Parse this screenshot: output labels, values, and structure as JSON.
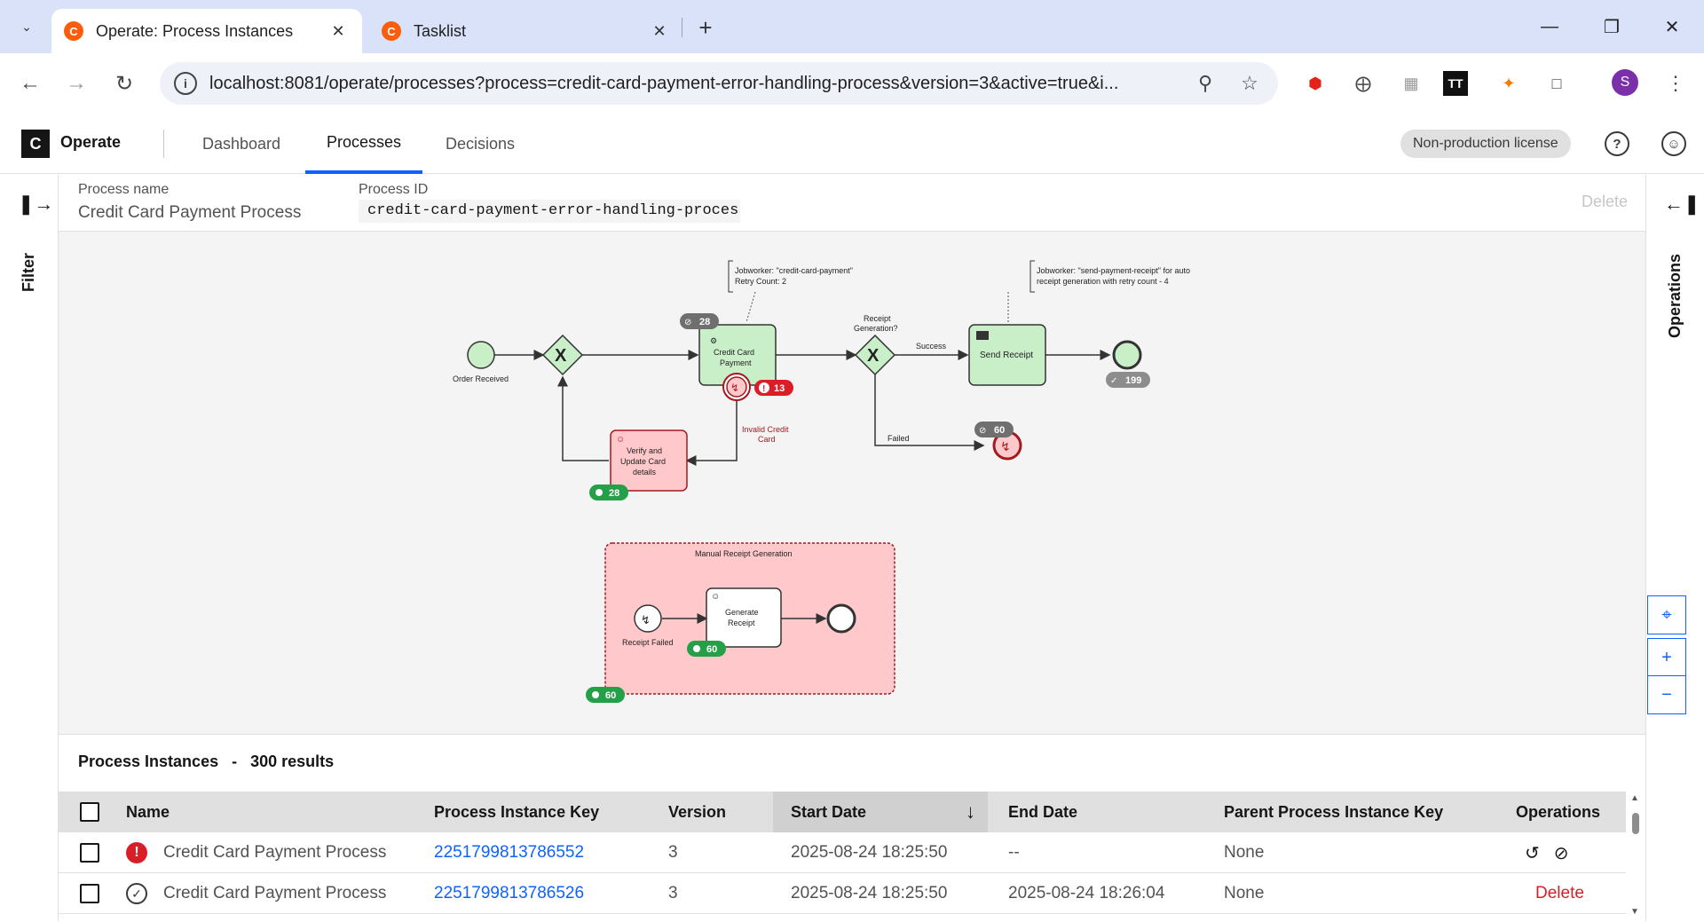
{
  "browser": {
    "tabs": [
      {
        "title": "Operate: Process Instances",
        "active": true
      },
      {
        "title": "Tasklist",
        "active": false
      }
    ],
    "url": "localhost:8081/operate/processes?process=credit-card-payment-error-handling-process&version=3&active=true&i...",
    "profile_initial": "S"
  },
  "app": {
    "logo": "C",
    "name": "Operate",
    "nav": [
      "Dashboard",
      "Processes",
      "Decisions"
    ],
    "active_nav": "Processes",
    "license": "Non-production license"
  },
  "left_panel": {
    "label": "Filter"
  },
  "right_panel": {
    "label": "Operations"
  },
  "process_header": {
    "name_label": "Process name",
    "name_value": "Credit Card Payment Process",
    "id_label": "Process ID",
    "id_value": "credit-card-payment-error-handling-process",
    "delete_label": "Delete"
  },
  "diagram": {
    "annotation_1": [
      "Jobworker: \"credit-card-payment\"",
      "Retry Count: 2"
    ],
    "annotation_2": [
      "Jobworker: \"send-payment-receipt\" for auto",
      "receipt generation with retry count - 4"
    ],
    "start_event": "Order Received",
    "gateway_label": [
      "Receipt",
      "Generation?"
    ],
    "task_credit_card": [
      "Credit Card",
      "Payment"
    ],
    "task_send_receipt": "Send Receipt",
    "task_verify": [
      "Verify and",
      "Update Card",
      "details"
    ],
    "flow_success": "Success",
    "flow_failed": "Failed",
    "flow_invalid": [
      "Invalid Credit",
      "Card"
    ],
    "subprocess_title": "Manual Receipt Generation",
    "subprocess_start": "Receipt Failed",
    "task_generate": [
      "Generate",
      "Receipt"
    ],
    "badges": {
      "credit_card_canceled": "28",
      "credit_card_incidents": "13",
      "end_completed": "199",
      "error_end_canceled": "60",
      "verify_active": "28",
      "generate_active": "60",
      "subprocess_active": "60"
    }
  },
  "instances": {
    "title": "Process Instances",
    "separator": "-",
    "count": "300 results",
    "columns": [
      "Name",
      "Process Instance Key",
      "Version",
      "Start Date",
      "End Date",
      "Parent Process Instance Key",
      "Operations"
    ],
    "rows": [
      {
        "status": "incident",
        "name": "Credit Card Payment Process",
        "key": "2251799813786552",
        "version": "3",
        "start": "2025-08-24 18:25:50",
        "end": "--",
        "parent": "None",
        "ops": "retry-cancel"
      },
      {
        "status": "completed",
        "name": "Credit Card Payment Process",
        "key": "2251799813786526",
        "version": "3",
        "start": "2025-08-24 18:25:50",
        "end": "2025-08-24 18:26:04",
        "parent": "None",
        "ops": "Delete"
      }
    ]
  },
  "colors": {
    "accent": "#0f62fe",
    "task_green": "#c9efc9",
    "task_red": "#ffc9cc",
    "badge_green": "#24a148",
    "badge_red": "#da1e28",
    "badge_gray": "#6f6f6f"
  }
}
